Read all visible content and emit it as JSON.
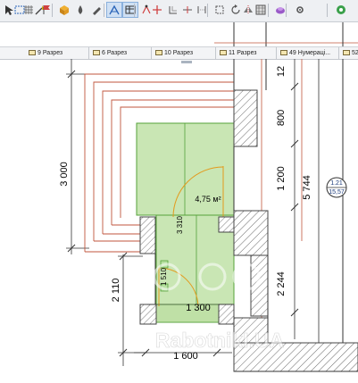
{
  "toolbar": {
    "items": [
      {
        "name": "pointer-arrow-icon"
      },
      {
        "name": "marquee-select-icon"
      },
      {
        "name": "snap-grid-icon"
      },
      {
        "name": "magic-wand-icon"
      },
      {
        "name": "flag-icon"
      },
      {
        "name": "layer-cube-icon"
      },
      {
        "name": "drop-icon"
      },
      {
        "name": "pen-icon"
      },
      {
        "name": "trace-reference-icon"
      },
      {
        "name": "table-icon"
      },
      {
        "name": "node-edit-icon"
      },
      {
        "name": "move-node-icon"
      },
      {
        "name": "offset-icon"
      },
      {
        "name": "split-icon"
      },
      {
        "name": "adjust-icon"
      },
      {
        "name": "explode-icon"
      },
      {
        "name": "rotate-icon"
      },
      {
        "name": "mirror-icon"
      },
      {
        "name": "grid-fill-icon"
      },
      {
        "name": "render-3d-icon"
      },
      {
        "name": "settings-icon"
      },
      {
        "name": "globe-icon"
      }
    ]
  },
  "tabs": [
    {
      "label": "9 Разрез"
    },
    {
      "label": "6 Разрез"
    },
    {
      "label": "10 Разрез"
    },
    {
      "label": "11 Разрез"
    },
    {
      "label": "49 Нумераці..."
    },
    {
      "label": "52"
    }
  ],
  "drawing": {
    "dims": {
      "left_vertical": "3 000",
      "lower_left_vertical": "2 110",
      "center_vertical": "3 310",
      "small_vertical": "1 510",
      "horizontal_1300": "1 300",
      "horizontal_1600": "1 600",
      "right_800": "800",
      "right_1200": "1 200",
      "right_2244": "2 244",
      "right_top_12": "12",
      "total_5744": "5 744"
    },
    "area_label": "4,75 м²",
    "marker_top": "1.21",
    "marker_bottom": "15,57",
    "watermark": "RabotnikI.UA",
    "colors": {
      "room_fill": "#c9e6b4",
      "room_stroke": "#55a23a",
      "orange_outline": "#c0563c",
      "wall_hatch": "#6b6b6b",
      "door_swing": "#e39a1c",
      "dim_line": "#333333"
    }
  }
}
